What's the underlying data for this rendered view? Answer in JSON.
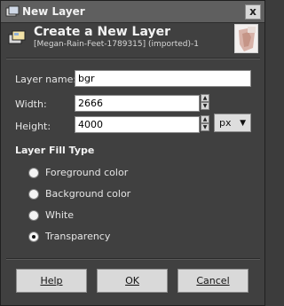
{
  "window": {
    "title": "New Layer",
    "close_glyph": "x"
  },
  "header": {
    "title": "Create a New Layer",
    "subtitle": "[Megan-Rain-Feet-1789315] (imported)-1"
  },
  "form": {
    "layer_name_label": "Layer name:",
    "layer_name_value": "bgr",
    "width_label": "Width:",
    "width_value": "2666",
    "height_label": "Height:",
    "height_value": "4000",
    "unit_value": "px"
  },
  "fill_type": {
    "heading": "Layer Fill Type",
    "options": [
      {
        "label": "Foreground color",
        "selected": false
      },
      {
        "label": "Background color",
        "selected": false
      },
      {
        "label": "White",
        "selected": false
      },
      {
        "label": "Transparency",
        "selected": true
      }
    ]
  },
  "buttons": {
    "help": "Help",
    "ok": "OK",
    "cancel": "Cancel"
  },
  "icons": {
    "app": "gimp-layer-icon",
    "header": "new-layer-icon",
    "thumbnail": "image-thumbnail"
  }
}
